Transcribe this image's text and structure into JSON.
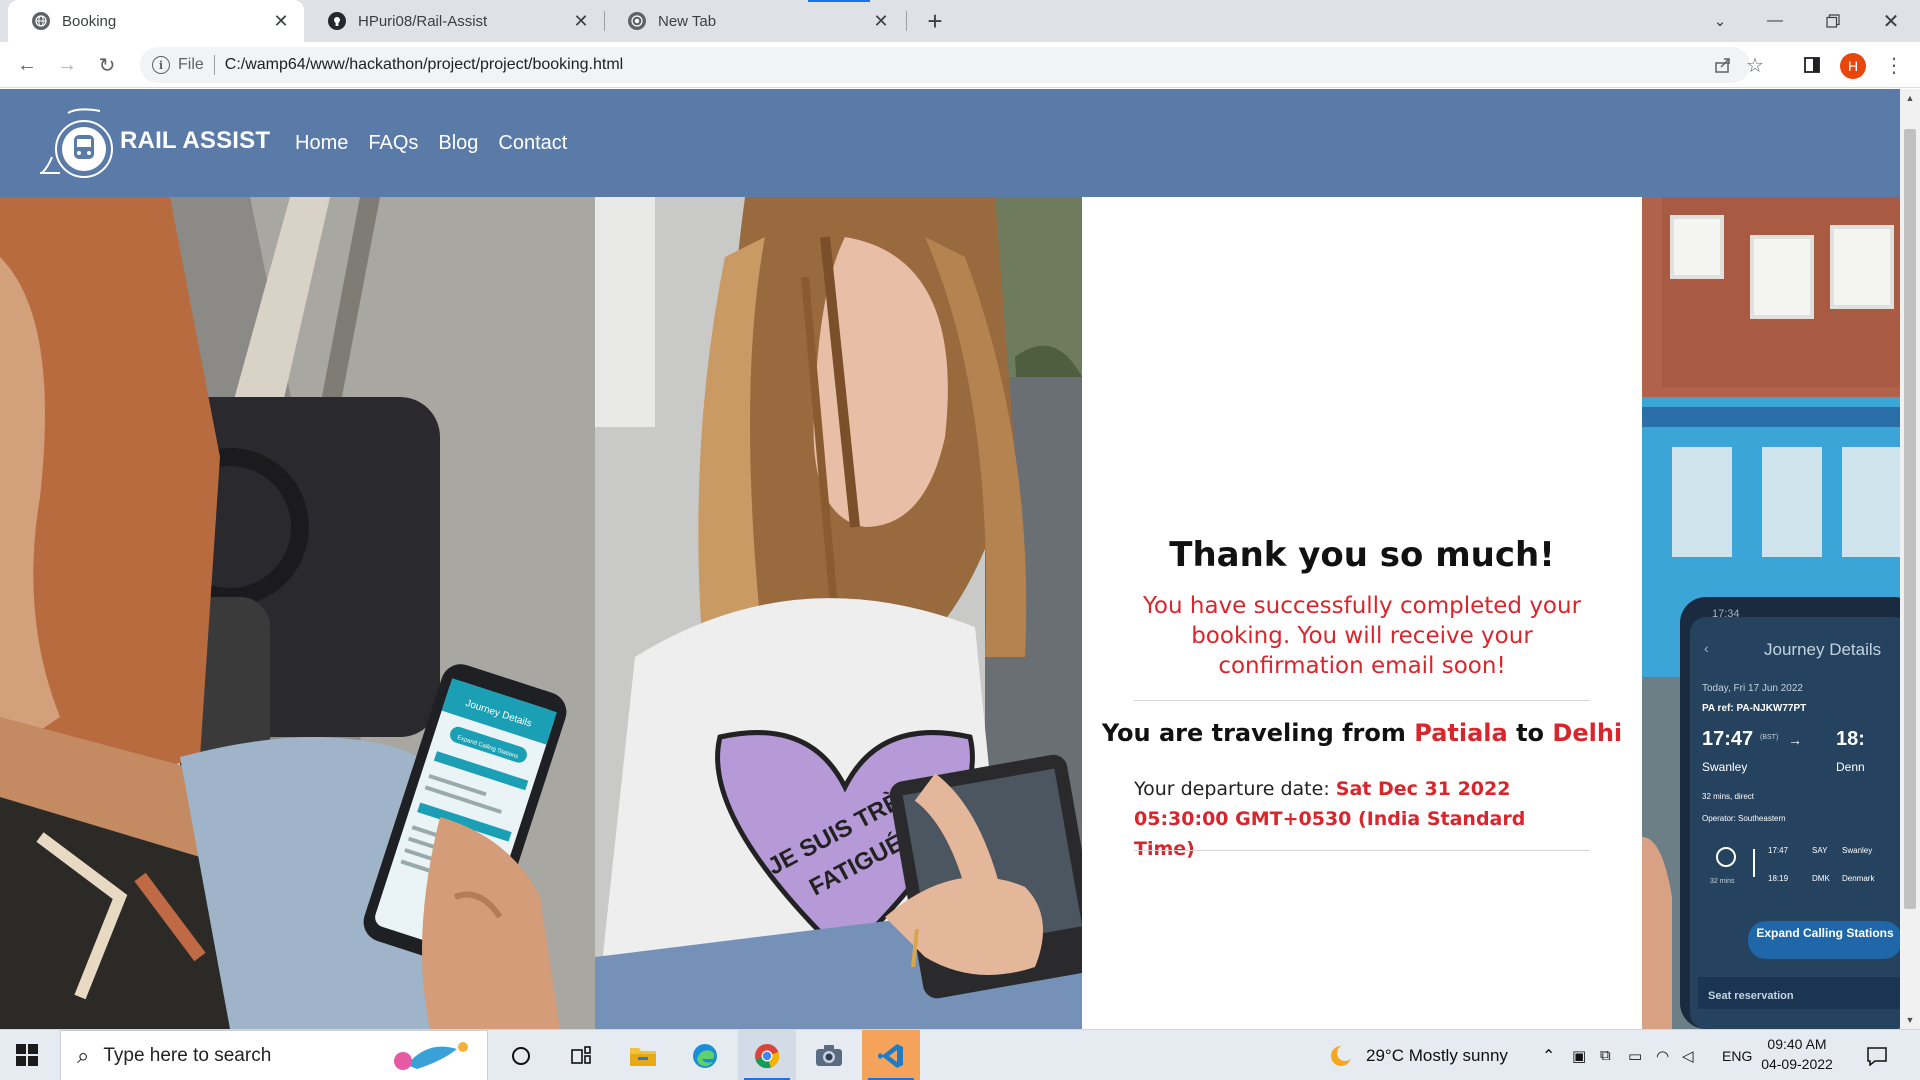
{
  "browser": {
    "tabs": [
      {
        "title": "Booking",
        "active": true
      },
      {
        "title": "HPuri08/Rail-Assist",
        "active": false
      },
      {
        "title": "New Tab",
        "active": false
      }
    ],
    "address": {
      "scheme": "File",
      "url": "C:/wamp64/www/hackathon/project/project/booking.html"
    },
    "profile_initial": "H"
  },
  "site": {
    "brand": "RAIL ASSIST",
    "nav": [
      {
        "label": "Home"
      },
      {
        "label": "FAQs"
      },
      {
        "label": "Blog"
      },
      {
        "label": "Contact"
      }
    ]
  },
  "confirmation": {
    "heading": "Thank you so much!",
    "message": "You have successfully completed your booking. You will receive your confirmation email soon!",
    "route_prefix": "You are traveling from",
    "origin": "Patiala",
    "route_joiner": "to",
    "destination": "Delhi",
    "departure_label": "Your departure date:",
    "departure_value": "Sat Dec 31 2022 05:30:00 GMT+0530 (India Standard Time)"
  },
  "photo_texts": {
    "phone1_header": "Journey Details",
    "phone1_button": "Expand Calling Stations",
    "shirt_text_1": "JE SUIS TRÈS",
    "shirt_text_2": "FATIGUÉ",
    "phone2_time": "17:34",
    "phone2_header": "Journey Details",
    "phone2_date": "Today, Fri 17 Jun 2022",
    "phone2_ref": "PA ref: PA-NJKW77PT",
    "phone2_dep_time": "17:47",
    "phone2_dep_tz": "(BST)",
    "phone2_arr_time": "18:",
    "phone2_from": "Swanley",
    "phone2_to": "Denn",
    "phone2_duration": "32 mins, direct",
    "phone2_operator": "Operator: Southeastern",
    "phone2_stop1_time": "17:47",
    "phone2_stop1_code": "SAY",
    "phone2_stop1_name": "Swanley",
    "phone2_stop2_time": "18:19",
    "phone2_stop2_code": "DMK",
    "phone2_stop2_name": "Denmark",
    "phone2_mins": "32 mins",
    "phone2_button": "Expand Calling Stations",
    "phone2_footer": "Seat reservation"
  },
  "taskbar": {
    "search_placeholder": "Type here to search",
    "weather": "29°C  Mostly sunny",
    "language": "ENG",
    "time": "09:40 AM",
    "date": "04-09-2022"
  },
  "colors": {
    "header": "#5a7aa8",
    "accent_red": "#d9252c",
    "taskbar": "#e6ebf1"
  }
}
